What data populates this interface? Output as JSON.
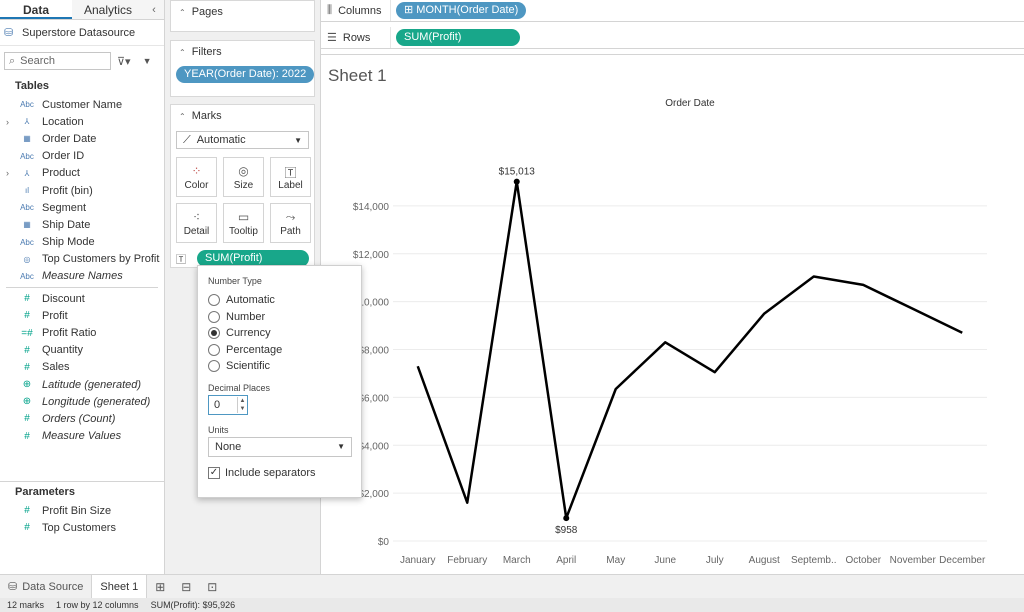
{
  "data_pane": {
    "tabs": [
      "Data",
      "Analytics"
    ],
    "collapse_icon": "chevron-left-icon",
    "datasource": "Superstore Datasource",
    "search_placeholder": "Search",
    "tables_heading": "Tables",
    "dimensions": [
      {
        "label": "Customer Name",
        "icon": "Abc",
        "expandable": false,
        "italic": false
      },
      {
        "label": "Location",
        "icon": "hierarchy-icon",
        "expandable": true,
        "italic": false
      },
      {
        "label": "Order Date",
        "icon": "calendar-icon",
        "expandable": false,
        "italic": false
      },
      {
        "label": "Order ID",
        "icon": "Abc",
        "expandable": false,
        "italic": false
      },
      {
        "label": "Product",
        "icon": "hierarchy-icon",
        "expandable": true,
        "italic": false
      },
      {
        "label": "Profit (bin)",
        "icon": "bin-icon",
        "expandable": false,
        "italic": false
      },
      {
        "label": "Segment",
        "icon": "Abc",
        "expandable": false,
        "italic": false
      },
      {
        "label": "Ship Date",
        "icon": "calendar-icon",
        "expandable": false,
        "italic": false
      },
      {
        "label": "Ship Mode",
        "icon": "Abc",
        "expandable": false,
        "italic": false
      },
      {
        "label": "Top Customers by Profit",
        "icon": "set-icon",
        "expandable": false,
        "italic": false
      },
      {
        "label": "Measure Names",
        "icon": "Abc",
        "expandable": false,
        "italic": true
      }
    ],
    "measures": [
      {
        "label": "Discount",
        "icon": "#",
        "italic": false
      },
      {
        "label": "Profit",
        "icon": "#",
        "italic": false
      },
      {
        "label": "Profit Ratio",
        "icon": "=#",
        "italic": false
      },
      {
        "label": "Quantity",
        "icon": "#",
        "italic": false
      },
      {
        "label": "Sales",
        "icon": "#",
        "italic": false
      },
      {
        "label": "Latitude (generated)",
        "icon": "globe-icon",
        "italic": true
      },
      {
        "label": "Longitude (generated)",
        "icon": "globe-icon",
        "italic": true
      },
      {
        "label": "Orders (Count)",
        "icon": "#",
        "italic": true
      },
      {
        "label": "Measure Values",
        "icon": "#",
        "italic": true
      }
    ],
    "parameters_heading": "Parameters",
    "parameters": [
      "Profit Bin Size",
      "Top Customers"
    ]
  },
  "shelves": {
    "pages_title": "Pages",
    "filters_title": "Filters",
    "filter_pill": "YEAR(Order Date): 2022",
    "marks_title": "Marks",
    "mark_type": "Automatic",
    "mark_buttons": [
      "Color",
      "Size",
      "Label",
      "Detail",
      "Tooltip",
      "Path"
    ],
    "label_pill": "SUM(Profit)",
    "columns_label": "Columns",
    "columns_pill": "MONTH(Order Date)",
    "rows_label": "Rows",
    "rows_pill": "SUM(Profit)"
  },
  "format_popover": {
    "number_type_heading": "Number Type",
    "options": [
      "Automatic",
      "Number",
      "Currency",
      "Percentage",
      "Scientific"
    ],
    "selected": "Currency",
    "decimal_heading": "Decimal Places",
    "decimal_value": "0",
    "units_heading": "Units",
    "units_value": "None",
    "separators_label": "Include separators",
    "separators_checked": true
  },
  "sheet": {
    "title": "Sheet 1"
  },
  "chart_data": {
    "type": "line",
    "title": "Order Date",
    "categories": [
      "January",
      "February",
      "March",
      "April",
      "May",
      "June",
      "July",
      "August",
      "Septemb..",
      "October",
      "November",
      "December"
    ],
    "series": [
      {
        "values": [
          7300,
          1600,
          15013,
          958,
          6350,
          8300,
          7050,
          9500,
          11050,
          10700,
          9700,
          8700
        ]
      }
    ],
    "y_ticks": [
      "$0",
      "$2,000",
      "$4,000",
      "$6,000",
      "$8,000",
      "$10,000",
      "$12,000",
      "$14,000"
    ],
    "ylim": [
      0,
      16000
    ],
    "annotations": [
      {
        "category": "March",
        "label": "$15,013"
      },
      {
        "category": "April",
        "label": "$958"
      }
    ],
    "line_color": "#000000",
    "grid": true
  },
  "bottom_tabs": {
    "data_source": "Data Source",
    "active_sheet": "Sheet 1",
    "icons": [
      "new-worksheet-icon",
      "new-dashboard-icon",
      "new-story-icon"
    ]
  },
  "status_bar": {
    "marks": "12 marks",
    "layout": "1 row by 12 columns",
    "sum": "SUM(Profit): $95,926"
  }
}
